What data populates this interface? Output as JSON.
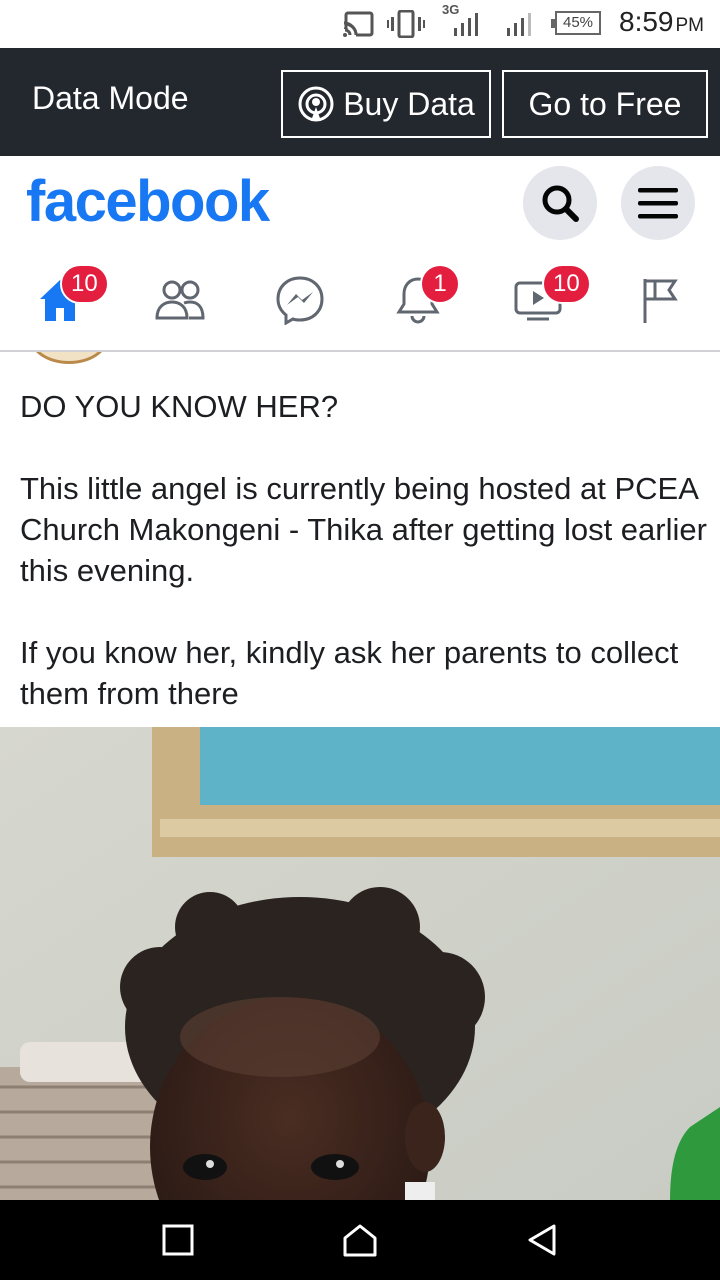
{
  "status_bar": {
    "network_label": "3G",
    "battery": "45%",
    "time": "8:59",
    "ampm": "PM",
    "icons": [
      "cast-icon",
      "vibrate-icon",
      "signal-3g-icon",
      "signal-icon",
      "battery-icon"
    ]
  },
  "data_banner": {
    "title": "Data Mode",
    "buy_label": "Buy Data",
    "free_label": "Go to Free"
  },
  "header": {
    "logo": "facebook",
    "brand_color": "#1877f2"
  },
  "nav_tabs": [
    {
      "name": "home",
      "icon": "home-icon",
      "badge": "10",
      "active": true
    },
    {
      "name": "friends",
      "icon": "friends-icon",
      "badge": ""
    },
    {
      "name": "messenger",
      "icon": "messenger-icon",
      "badge": ""
    },
    {
      "name": "notifications",
      "icon": "bell-icon",
      "badge": "1"
    },
    {
      "name": "watch",
      "icon": "video-icon",
      "badge": "10"
    },
    {
      "name": "pages",
      "icon": "flag-icon",
      "badge": ""
    }
  ],
  "post": {
    "paragraphs": [
      "DO YOU KNOW HER?",
      "This little angel is currently being hosted at PCEA Church Makongeni - Thika after getting lost earlier this evening.",
      "If you know her, kindly ask her parents to collect them from there"
    ]
  },
  "colors": {
    "badge": "#e41e3f",
    "banner_bg": "#23272e",
    "nav_icon": "#606770"
  }
}
